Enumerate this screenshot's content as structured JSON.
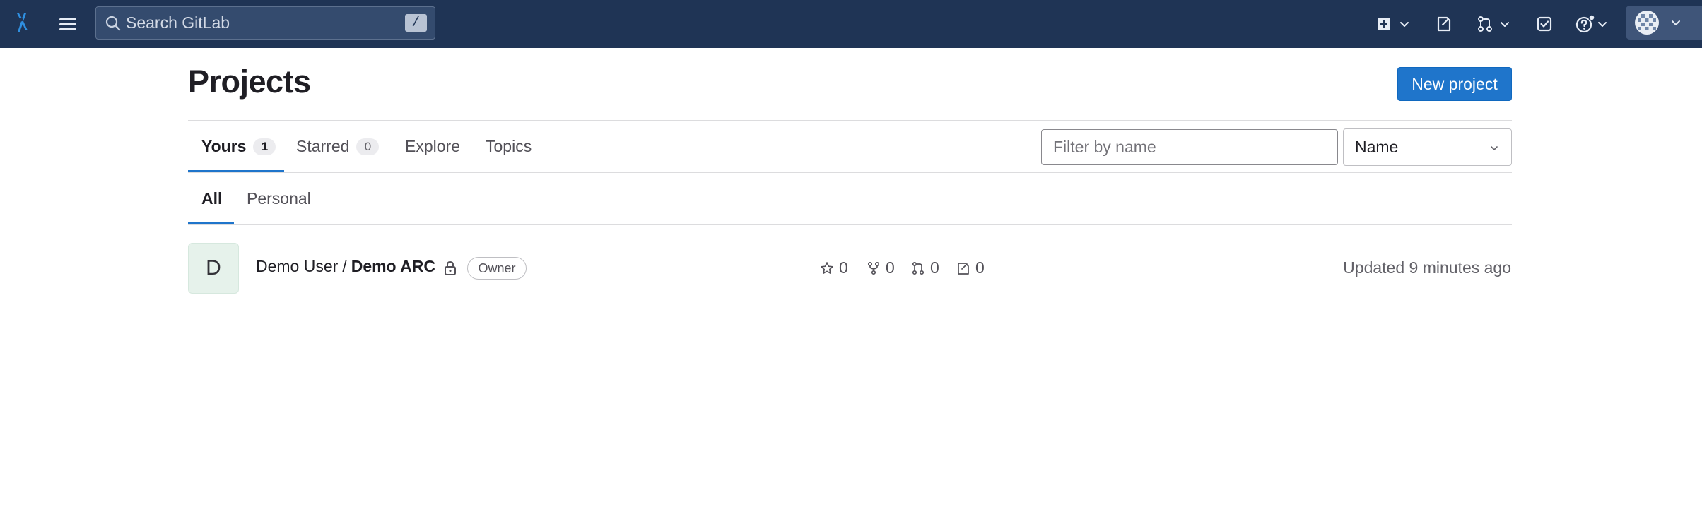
{
  "navbar": {
    "search_placeholder": "Search GitLab",
    "search_shortcut": "/"
  },
  "page": {
    "title": "Projects",
    "new_project_label": "New project"
  },
  "tabs": [
    {
      "label": "Yours",
      "count": "1",
      "active": true
    },
    {
      "label": "Starred",
      "count": "0",
      "active": false
    },
    {
      "label": "Explore",
      "active": false
    },
    {
      "label": "Topics",
      "active": false
    }
  ],
  "filter": {
    "placeholder": "Filter by name",
    "sort_value": "Name"
  },
  "subtabs": [
    {
      "label": "All",
      "active": true
    },
    {
      "label": "Personal",
      "active": false
    }
  ],
  "project": {
    "avatar_letter": "D",
    "namespace": "Demo User",
    "separator": "/",
    "name": "Demo ARC",
    "visibility": "private",
    "role": "Owner",
    "stars": "0",
    "forks": "0",
    "merge_requests": "0",
    "issues": "0",
    "updated": "Updated 9 minutes ago"
  },
  "colors": {
    "navbar_bg": "#1f3455",
    "primary": "#1f75cb",
    "project_avatar_bg": "#e6f2eb"
  }
}
